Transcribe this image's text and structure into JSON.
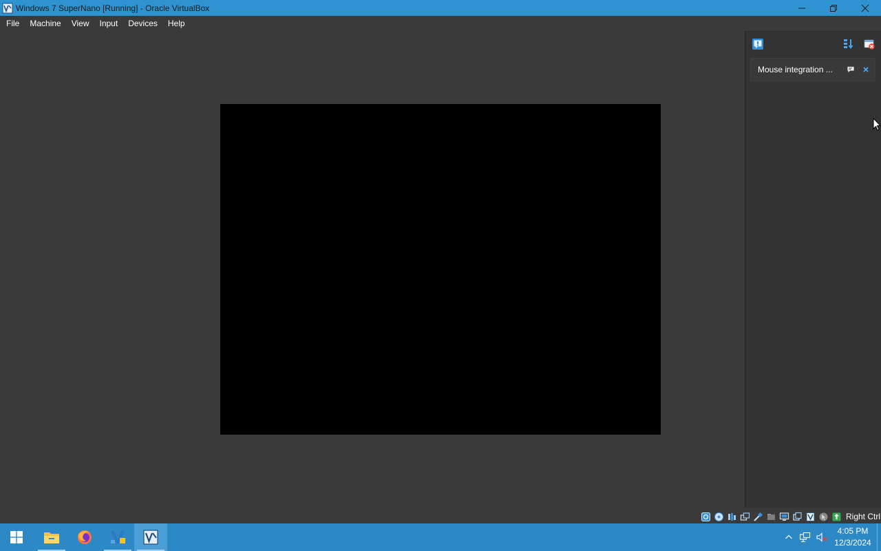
{
  "window": {
    "title": "Windows 7 SuperNano [Running] - Oracle VirtualBox",
    "icon": "virtualbox-icon"
  },
  "menu": {
    "items": [
      "File",
      "Machine",
      "View",
      "Input",
      "Devices",
      "Help"
    ]
  },
  "notification_center": {
    "notification_text": "Mouse integration ..."
  },
  "statusbar": {
    "host_key": "Right Ctrl"
  },
  "taskbar": {
    "apps": [
      "windows-start-icon",
      "file-explorer-icon",
      "firefox-icon",
      "vscode-icon",
      "virtualbox-icon"
    ],
    "clock_time": "4:05 PM",
    "clock_date": "12/3/2024"
  },
  "colors": {
    "titlebar": "#2f93d1",
    "taskbar": "#2d88c6",
    "background": "#3a3a3a",
    "vm_screen": "#000000"
  }
}
